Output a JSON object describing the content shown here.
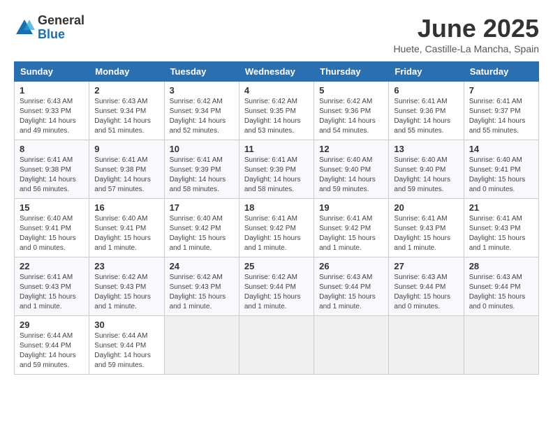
{
  "logo": {
    "general": "General",
    "blue": "Blue"
  },
  "title": "June 2025",
  "location": "Huete, Castille-La Mancha, Spain",
  "headers": [
    "Sunday",
    "Monday",
    "Tuesday",
    "Wednesday",
    "Thursday",
    "Friday",
    "Saturday"
  ],
  "weeks": [
    [
      {
        "day": "1",
        "info": "Sunrise: 6:43 AM\nSunset: 9:33 PM\nDaylight: 14 hours\nand 49 minutes."
      },
      {
        "day": "2",
        "info": "Sunrise: 6:43 AM\nSunset: 9:34 PM\nDaylight: 14 hours\nand 51 minutes."
      },
      {
        "day": "3",
        "info": "Sunrise: 6:42 AM\nSunset: 9:34 PM\nDaylight: 14 hours\nand 52 minutes."
      },
      {
        "day": "4",
        "info": "Sunrise: 6:42 AM\nSunset: 9:35 PM\nDaylight: 14 hours\nand 53 minutes."
      },
      {
        "day": "5",
        "info": "Sunrise: 6:42 AM\nSunset: 9:36 PM\nDaylight: 14 hours\nand 54 minutes."
      },
      {
        "day": "6",
        "info": "Sunrise: 6:41 AM\nSunset: 9:36 PM\nDaylight: 14 hours\nand 55 minutes."
      },
      {
        "day": "7",
        "info": "Sunrise: 6:41 AM\nSunset: 9:37 PM\nDaylight: 14 hours\nand 55 minutes."
      }
    ],
    [
      {
        "day": "8",
        "info": "Sunrise: 6:41 AM\nSunset: 9:38 PM\nDaylight: 14 hours\nand 56 minutes."
      },
      {
        "day": "9",
        "info": "Sunrise: 6:41 AM\nSunset: 9:38 PM\nDaylight: 14 hours\nand 57 minutes."
      },
      {
        "day": "10",
        "info": "Sunrise: 6:41 AM\nSunset: 9:39 PM\nDaylight: 14 hours\nand 58 minutes."
      },
      {
        "day": "11",
        "info": "Sunrise: 6:41 AM\nSunset: 9:39 PM\nDaylight: 14 hours\nand 58 minutes."
      },
      {
        "day": "12",
        "info": "Sunrise: 6:40 AM\nSunset: 9:40 PM\nDaylight: 14 hours\nand 59 minutes."
      },
      {
        "day": "13",
        "info": "Sunrise: 6:40 AM\nSunset: 9:40 PM\nDaylight: 14 hours\nand 59 minutes."
      },
      {
        "day": "14",
        "info": "Sunrise: 6:40 AM\nSunset: 9:41 PM\nDaylight: 15 hours\nand 0 minutes."
      }
    ],
    [
      {
        "day": "15",
        "info": "Sunrise: 6:40 AM\nSunset: 9:41 PM\nDaylight: 15 hours\nand 0 minutes."
      },
      {
        "day": "16",
        "info": "Sunrise: 6:40 AM\nSunset: 9:41 PM\nDaylight: 15 hours\nand 1 minute."
      },
      {
        "day": "17",
        "info": "Sunrise: 6:40 AM\nSunset: 9:42 PM\nDaylight: 15 hours\nand 1 minute."
      },
      {
        "day": "18",
        "info": "Sunrise: 6:41 AM\nSunset: 9:42 PM\nDaylight: 15 hours\nand 1 minute."
      },
      {
        "day": "19",
        "info": "Sunrise: 6:41 AM\nSunset: 9:42 PM\nDaylight: 15 hours\nand 1 minute."
      },
      {
        "day": "20",
        "info": "Sunrise: 6:41 AM\nSunset: 9:43 PM\nDaylight: 15 hours\nand 1 minute."
      },
      {
        "day": "21",
        "info": "Sunrise: 6:41 AM\nSunset: 9:43 PM\nDaylight: 15 hours\nand 1 minute."
      }
    ],
    [
      {
        "day": "22",
        "info": "Sunrise: 6:41 AM\nSunset: 9:43 PM\nDaylight: 15 hours\nand 1 minute."
      },
      {
        "day": "23",
        "info": "Sunrise: 6:42 AM\nSunset: 9:43 PM\nDaylight: 15 hours\nand 1 minute."
      },
      {
        "day": "24",
        "info": "Sunrise: 6:42 AM\nSunset: 9:43 PM\nDaylight: 15 hours\nand 1 minute."
      },
      {
        "day": "25",
        "info": "Sunrise: 6:42 AM\nSunset: 9:44 PM\nDaylight: 15 hours\nand 1 minute."
      },
      {
        "day": "26",
        "info": "Sunrise: 6:43 AM\nSunset: 9:44 PM\nDaylight: 15 hours\nand 1 minute."
      },
      {
        "day": "27",
        "info": "Sunrise: 6:43 AM\nSunset: 9:44 PM\nDaylight: 15 hours\nand 0 minutes."
      },
      {
        "day": "28",
        "info": "Sunrise: 6:43 AM\nSunset: 9:44 PM\nDaylight: 15 hours\nand 0 minutes."
      }
    ],
    [
      {
        "day": "29",
        "info": "Sunrise: 6:44 AM\nSunset: 9:44 PM\nDaylight: 14 hours\nand 59 minutes."
      },
      {
        "day": "30",
        "info": "Sunrise: 6:44 AM\nSunset: 9:44 PM\nDaylight: 14 hours\nand 59 minutes."
      },
      {
        "day": "",
        "info": ""
      },
      {
        "day": "",
        "info": ""
      },
      {
        "day": "",
        "info": ""
      },
      {
        "day": "",
        "info": ""
      },
      {
        "day": "",
        "info": ""
      }
    ]
  ]
}
